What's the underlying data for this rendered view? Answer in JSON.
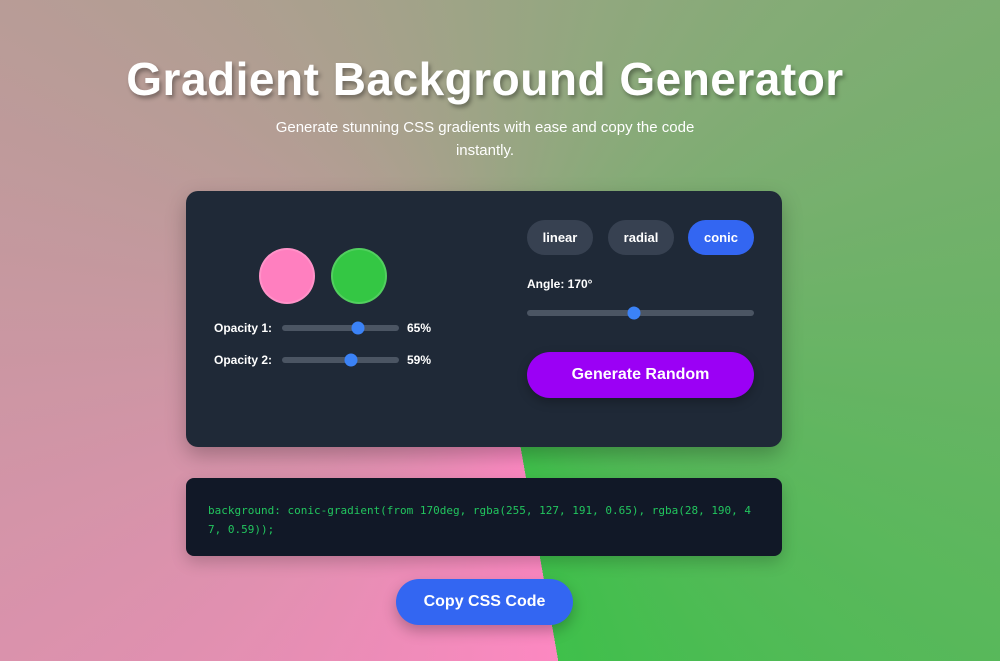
{
  "header": {
    "title": "Gradient Background Generator",
    "subtitle": "Generate stunning CSS gradients with ease and copy the code instantly."
  },
  "colors": {
    "color1": "#ff7fbf",
    "color2": "#34c744",
    "panel_bg": "#1f2937",
    "accent": "#3366f2",
    "generate": "#9b00f5",
    "code_text": "#22c55e"
  },
  "opacity": {
    "opacity1": {
      "label": "Opacity 1:",
      "value_text": "65%",
      "value": 0.65
    },
    "opacity2": {
      "label": "Opacity 2:",
      "value_text": "59%",
      "value": 0.59
    }
  },
  "gradient_types": [
    {
      "label": "linear",
      "active": false
    },
    {
      "label": "radial",
      "active": false
    },
    {
      "label": "conic",
      "active": true
    }
  ],
  "angle": {
    "label": "Angle: 170°",
    "value": 170,
    "min": 0,
    "max": 360
  },
  "buttons": {
    "generate_label": "Generate Random",
    "copy_label": "Copy CSS Code"
  },
  "css_output": "background: conic-gradient(from 170deg, rgba(255, 127, 191, 0.65), rgba(28, 190, 47, 0.59));"
}
